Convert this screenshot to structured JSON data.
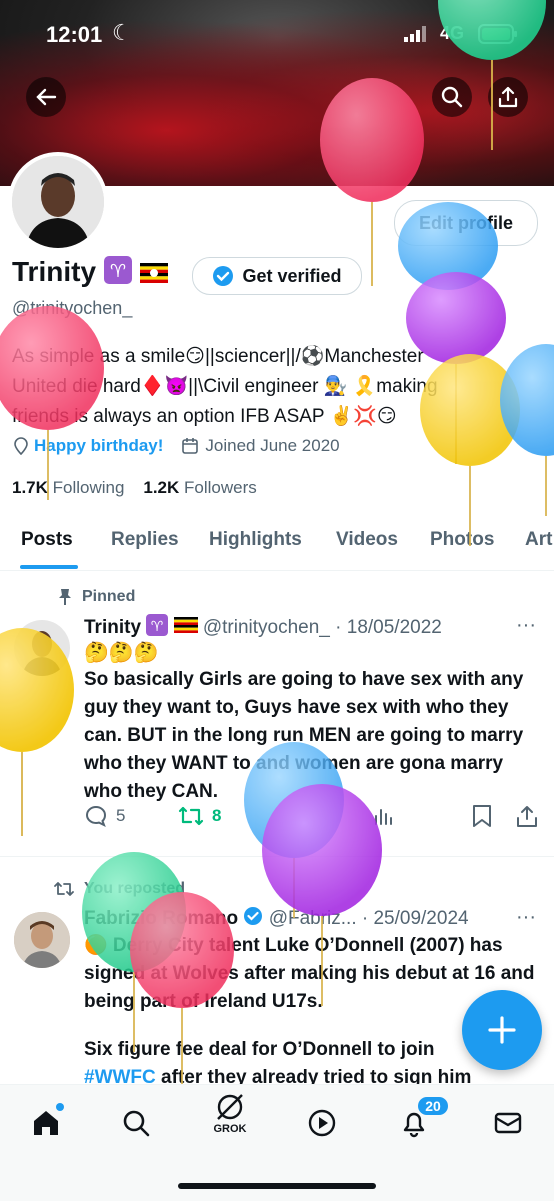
{
  "status": {
    "time": "12:01",
    "network": "4G"
  },
  "profile": {
    "name": "Trinity",
    "get_verified": "Get verified",
    "handle": "@trinityochen_",
    "edit_profile": "Edit profile",
    "bio_line1": "As simple as a smile😏||sciencer||/⚽Manchester",
    "bio_line2": "United die hard♦️👿||\\Civil engineer 👨‍🔧 🎗️making",
    "bio_line3": "friends is always an option IFB ASAP ✌️💢😏",
    "birthday": "Happy birthday!",
    "joined": "Joined June 2020",
    "following_count": "1.7K",
    "following_label": "Following",
    "followers_count": "1.2K",
    "followers_label": "Followers"
  },
  "tabs": [
    "Posts",
    "Replies",
    "Highlights",
    "Videos",
    "Photos",
    "Art"
  ],
  "tweet1": {
    "pinned_label": "Pinned",
    "name": "Trinity",
    "handle_date": "@trinityochen_ · 18/05/2022",
    "emojis": "🤔🤔🤔",
    "text": "So basically Girls are going to have sex with any guy they want to, Guys have sex with who they can. BUT in the long run MEN are going to marry who they WANT to and women are gona marry who they CAN.",
    "replies": "5",
    "reposts": "8"
  },
  "tweet2": {
    "reposted_label": "You reposted",
    "name": "Fabrizio Romano",
    "handle_date": "@Fabriz... · 25/09/2024",
    "line1": "🟠 Derry City talent Luke O’Donnell (2007) has signed at Wolves after making his debut at 16 and being part of Ireland U17s.",
    "line2_prefix": "Six figure fee deal for O’Donnell to join",
    "hashtag": "#WWFC",
    "line2_suffix": " after they already tried to sign him"
  },
  "nav": {
    "grok_label": "GROK",
    "notifications_badge": "20"
  },
  "colors": {
    "accent": "#1d9bf0",
    "repost_green": "#00ba7c",
    "text": "#0f1419",
    "muted": "#536471"
  }
}
